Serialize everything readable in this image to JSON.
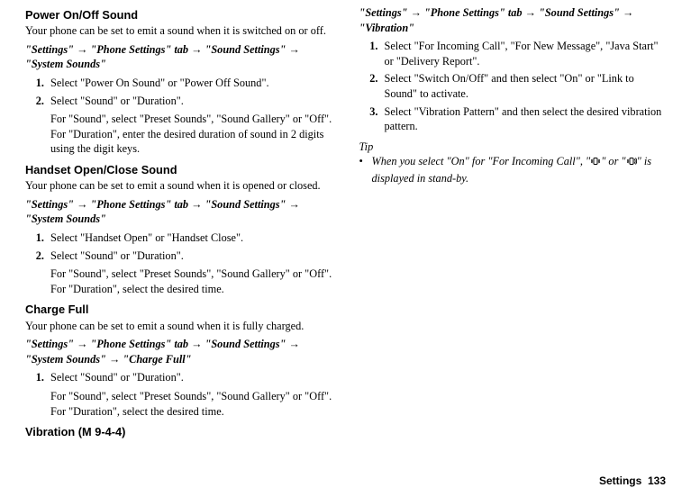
{
  "sections": {
    "power": {
      "heading": "Power On/Off Sound",
      "intro": "Your phone can be set to emit a sound when it is switched on or off.",
      "path": "\"Settings\" → \"Phone Settings\" tab → \"Sound Settings\" → \"System Sounds\"",
      "step1": "Select \"Power On Sound\" or \"Power Off Sound\".",
      "step2": "Select \"Sound\" or \"Duration\".",
      "step2sub": "For \"Sound\", select \"Preset Sounds\", \"Sound Gallery\" or \"Off\".\nFor \"Duration\", enter the desired duration of sound in 2 digits using the digit keys."
    },
    "handset": {
      "heading": "Handset Open/Close Sound",
      "intro": "Your phone can be set to emit a sound when it is opened or closed.",
      "path": "\"Settings\" → \"Phone Settings\" tab → \"Sound Settings\" → \"System Sounds\"",
      "step1": "Select \"Handset Open\" or \"Handset Close\".",
      "step2": "Select \"Sound\" or \"Duration\".",
      "step2sub": "For \"Sound\", select \"Preset Sounds\", \"Sound Gallery\" or \"Off\".\nFor \"Duration\", select the desired time."
    },
    "charge": {
      "heading": "Charge Full",
      "intro": "Your phone can be set to emit a sound when it is fully charged.",
      "path": "\"Settings\" → \"Phone Settings\" tab → \"Sound Settings\" → \"System Sounds\" → \"Charge Full\"",
      "step1": "Select \"Sound\" or \"Duration\".",
      "step1sub": "For \"Sound\", select \"Preset Sounds\", \"Sound Gallery\" or \"Off\".\nFor \"Duration\", select the desired time."
    },
    "vibration": {
      "heading": "Vibration",
      "mcode": "(M 9-4-4)",
      "path": "\"Settings\" → \"Phone Settings\" tab → \"Sound Settings\" → \"Vibration\"",
      "step1": "Select \"For Incoming Call\", \"For New Message\", \"Java Start\" or \"Delivery Report\".",
      "step2": "Select \"Switch On/Off\" and then select \"On\" or \"Link to Sound\" to activate.",
      "step3": "Select \"Vibration Pattern\" and then select the desired vibration pattern."
    },
    "tip": {
      "label": "Tip",
      "text_before": "When you select \"On\" for \"For Incoming Call\", \"",
      "text_mid": "\" or \"",
      "text_after": "\" is displayed in stand-by."
    }
  },
  "footer": {
    "category": "Settings",
    "page": "133"
  },
  "icons": {
    "vibrate1": "vibrate-icon",
    "vibrate2": "vibrate-ring-icon"
  }
}
